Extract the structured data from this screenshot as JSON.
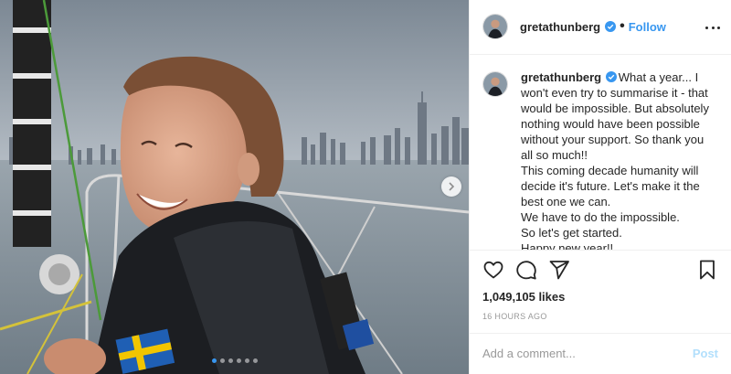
{
  "post": {
    "username": "gretathunberg",
    "follow_label": "Follow",
    "separator": "•",
    "caption_lines": [
      "What a year... I",
      "won't even try to summarise it - that",
      "would be impossible. But absolutely",
      "nothing would have been possible",
      "without your support. So thank you",
      "all so much!!",
      "This coming decade humanity will",
      "decide it's future. Let's make it the",
      "best one we can.",
      "We have to do the impossible.",
      "So let's get started.",
      "Happy new year!!"
    ],
    "likes": "1,049,105 likes",
    "timestamp": "16 HOURS AGO",
    "comment_placeholder": "Add a comment...",
    "post_button": "Post",
    "carousel_dots": 6,
    "carousel_active": 0
  },
  "colors": {
    "accent": "#3897f0",
    "post_disabled": "#b2dffc",
    "muted": "#999999"
  },
  "icons": {
    "like": "heart-icon",
    "comment": "comment-icon",
    "share": "share-icon",
    "save": "bookmark-icon",
    "more": "more-options-icon",
    "next": "chevron-right-icon",
    "verified": "verified-badge-icon"
  }
}
